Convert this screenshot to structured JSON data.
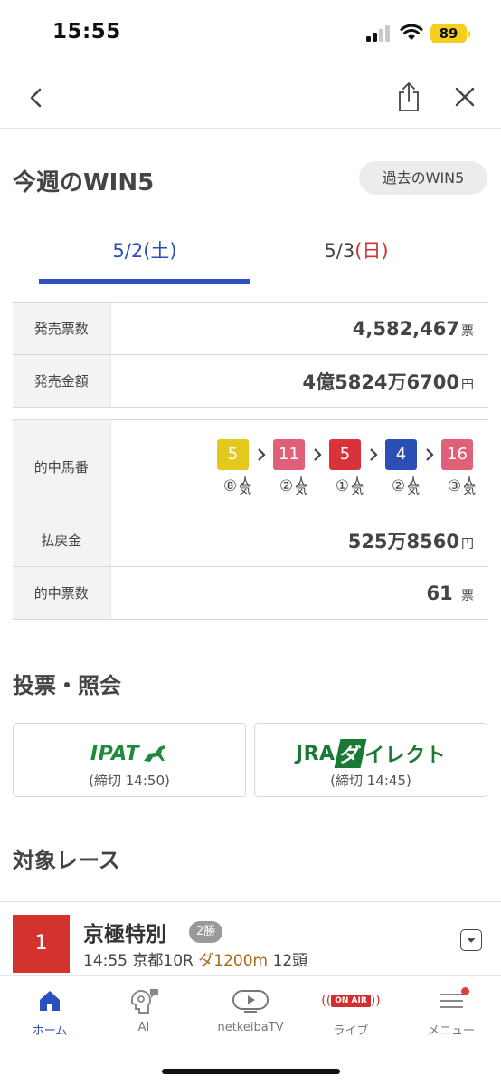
{
  "status": {
    "time": "15:55",
    "battery": "89"
  },
  "header": {
    "title": "今週のWIN5",
    "past_button": "過去のWIN5"
  },
  "tabs": [
    {
      "date": "5/2",
      "day": "(土)"
    },
    {
      "date": "5/3",
      "day": "(日)"
    }
  ],
  "sales": {
    "tickets_label": "発売票数",
    "tickets_value": "4,582,467",
    "tickets_unit": "票",
    "amount_label": "発売金額",
    "amount_value": "4億5824万6700",
    "amount_unit": "円"
  },
  "result": {
    "winners_label": "的中馬番",
    "horses": [
      {
        "number": "5",
        "popularity": "⑧",
        "color": "#e3c81e"
      },
      {
        "number": "11",
        "popularity": "②",
        "color": "#e0607a"
      },
      {
        "number": "5",
        "popularity": "①",
        "color": "#d8323a"
      },
      {
        "number": "4",
        "popularity": "②",
        "color": "#2c4fb6"
      },
      {
        "number": "16",
        "popularity": "③",
        "color": "#e0607a"
      }
    ],
    "popularity_unit": "人気",
    "payout_label": "払戻金",
    "payout_value": "525万8560",
    "payout_unit": "円",
    "hit_label": "的中票数",
    "hit_value": "61",
    "hit_unit": "票"
  },
  "vote": {
    "title": "投票・照会",
    "ipat": {
      "logo": "IPAT",
      "deadline": "(締切 14:50)"
    },
    "jra": {
      "logo_1": "JRA",
      "logo_2": "ダ",
      "logo_3": "イレクト",
      "deadline": "(締切 14:45)"
    }
  },
  "races": {
    "title": "対象レース",
    "items": [
      {
        "num": "1",
        "name": "京極特別",
        "class": "2勝",
        "time": "14:55",
        "venue": "京都10R",
        "course": "ダ1200m",
        "heads": "12頭"
      }
    ]
  },
  "tabbar": {
    "items": [
      {
        "label": "ホーム"
      },
      {
        "label": "AI"
      },
      {
        "label": "netkeibaTV"
      },
      {
        "label": "ライブ",
        "badge": "ON AIR"
      },
      {
        "label": "メニュー"
      }
    ]
  },
  "colors": {
    "accent": "#2e50c0",
    "saturday": "#2a4fbf",
    "sunday": "#d03030",
    "race_red": "#d4322e",
    "green": "#1f8a3b"
  }
}
